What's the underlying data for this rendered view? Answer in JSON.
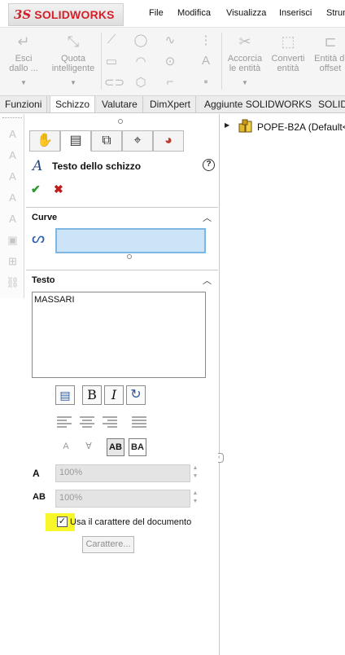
{
  "app": {
    "brand": "SOLIDWORKS",
    "logo_mark": "3S"
  },
  "menu": {
    "items": [
      "File",
      "Modifica",
      "Visualizza",
      "Inserisci",
      "Strum"
    ]
  },
  "ribbon": {
    "exit_sketch": [
      "Esci",
      "dallo ..."
    ],
    "smart_dimension": [
      "Quota",
      "intelligente"
    ],
    "trim_entities": [
      "Accorcia",
      "le entità"
    ],
    "convert_entities": [
      "Converti",
      "entità"
    ],
    "offset_entities": [
      "Entità di",
      "offset"
    ]
  },
  "tabs": {
    "items": [
      "Funzioni",
      "Schizzo",
      "Valutare",
      "DimXpert",
      "Aggiunte SOLIDWORKS",
      "SOLID"
    ],
    "active": "Schizzo"
  },
  "property_manager": {
    "title": "Testo dello schizzo",
    "help": "?",
    "ok": "✔",
    "cancel": "✖",
    "curves_group": "Curve",
    "curves_value": "",
    "text_group": "Testo",
    "text_value": "MASSARI",
    "width_factor": "100%",
    "spacing": "100%",
    "use_document_font_label": "Usa il carattere del documento",
    "use_document_font_checked": true,
    "font_button": "Carattere...",
    "bold_label": "B",
    "italic_label": "I",
    "width_icon_label": "A",
    "spacing_icon_label": "AB",
    "flip_horizontal_label": "AB",
    "flip_vertical_label": "BA"
  },
  "feature_tree": {
    "root_label": "POPE-B2A  (Default<"
  }
}
